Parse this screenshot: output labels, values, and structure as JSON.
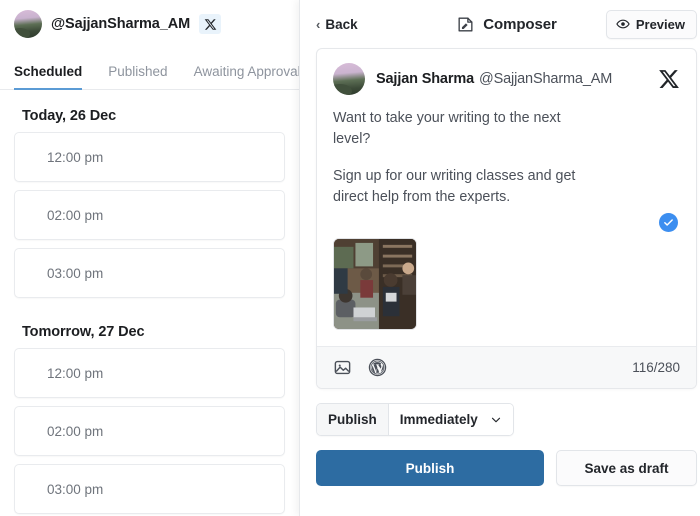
{
  "left": {
    "account": {
      "handle": "@SajjanSharma_AM",
      "network_icon": "x-logo-icon",
      "avatar_icon": "avatar"
    },
    "tabs": [
      {
        "label": "Scheduled",
        "active": true
      },
      {
        "label": "Published",
        "active": false
      },
      {
        "label": "Awaiting Approval",
        "active": false
      }
    ],
    "groups": [
      {
        "heading": "Today, 26 Dec",
        "slots": [
          {
            "time": "12:00 pm"
          },
          {
            "time": "02:00 pm"
          },
          {
            "time": "03:00 pm"
          }
        ]
      },
      {
        "heading": "Tomorrow, 27 Dec",
        "slots": [
          {
            "time": "12:00 pm"
          },
          {
            "time": "02:00 pm"
          },
          {
            "time": "03:00 pm"
          }
        ]
      }
    ]
  },
  "composer": {
    "back_label": "Back",
    "title": "Composer",
    "title_icon": "compose-icon",
    "preview_label": "Preview",
    "preview_icon": "eye-icon",
    "post": {
      "author_name": "Sajjan Sharma",
      "author_handle": "@SajjanSharma_AM",
      "network_icon": "x-logo-icon",
      "paragraphs": [
        "Want to take your writing to the next level?",
        "Sign up for our writing classes and get direct help from the experts."
      ],
      "verified_icon": "check-circle-icon",
      "media_alt": "people working on laptops in a cafe",
      "toolbar": {
        "image_icon": "image-icon",
        "wordpress_icon": "wordpress-icon",
        "char_count": "116/280"
      }
    },
    "publish": {
      "segment_label": "Publish",
      "schedule_value": "Immediately",
      "chevron_icon": "chevron-down-icon",
      "primary_button": "Publish",
      "secondary_button": "Save as draft"
    }
  },
  "colors": {
    "accent_blue": "#2d6ca2",
    "tab_underline": "#5b9bd5",
    "verified_blue": "#3c8ef0",
    "x_badge_bg": "#e9f3fb",
    "toolbar_bg": "#f7f8f9",
    "border": "#e6e8eb",
    "text_primary": "#1c1e21",
    "text_muted": "#6f747c"
  }
}
